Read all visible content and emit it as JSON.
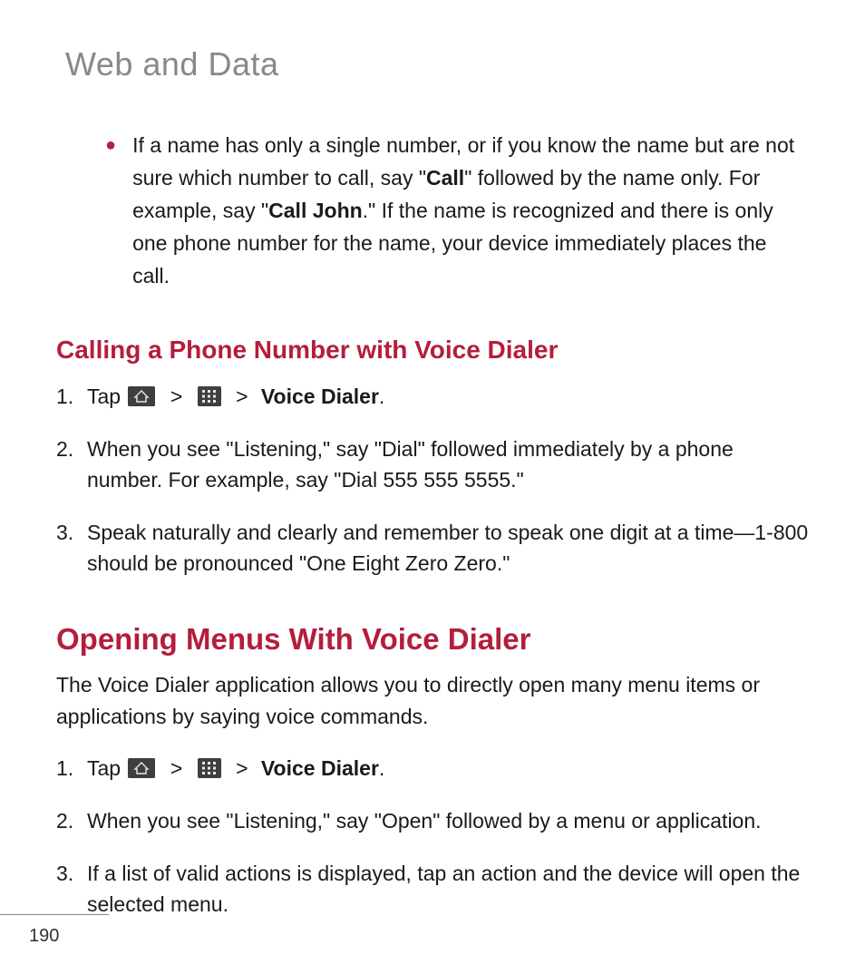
{
  "header": {
    "title": "Web and Data"
  },
  "bullet": {
    "pre": " If a name has only a single number, or if you know the name but are not sure which number to call, say \"",
    "bold1": "Call",
    "mid": "\" followed by the name only. For example, say \"",
    "bold2": "Call John",
    "post": ".\" If the name is recognized and there is only one phone number for the name, your device immediately places the call."
  },
  "section1": {
    "heading": "Calling a Phone Number with Voice Dialer",
    "step1": {
      "tap": "Tap ",
      "voice_dialer": "Voice Dialer",
      "period": "."
    },
    "step2": "When you see \"Listening,\" say \"Dial\" followed immediately by a phone number. For example, say \"Dial 555 555 5555.\"",
    "step3": "Speak naturally and clearly and remember to speak one digit at a time—1-800 should be pronounced \"One Eight Zero Zero.\""
  },
  "section2": {
    "heading": "Opening Menus With Voice Dialer",
    "intro": "The Voice Dialer application allows you to directly open many menu items or applications by saying voice commands.",
    "step1": {
      "tap": "Tap ",
      "voice_dialer": "Voice Dialer",
      "period": "."
    },
    "step2": "When you see \"Listening,\" say \"Open\" followed by a menu or application.",
    "step3": "If a list of valid actions is displayed, tap an action and the device will open the selected menu."
  },
  "footer": {
    "page_number": "190"
  },
  "glyphs": {
    "gt": ">"
  }
}
